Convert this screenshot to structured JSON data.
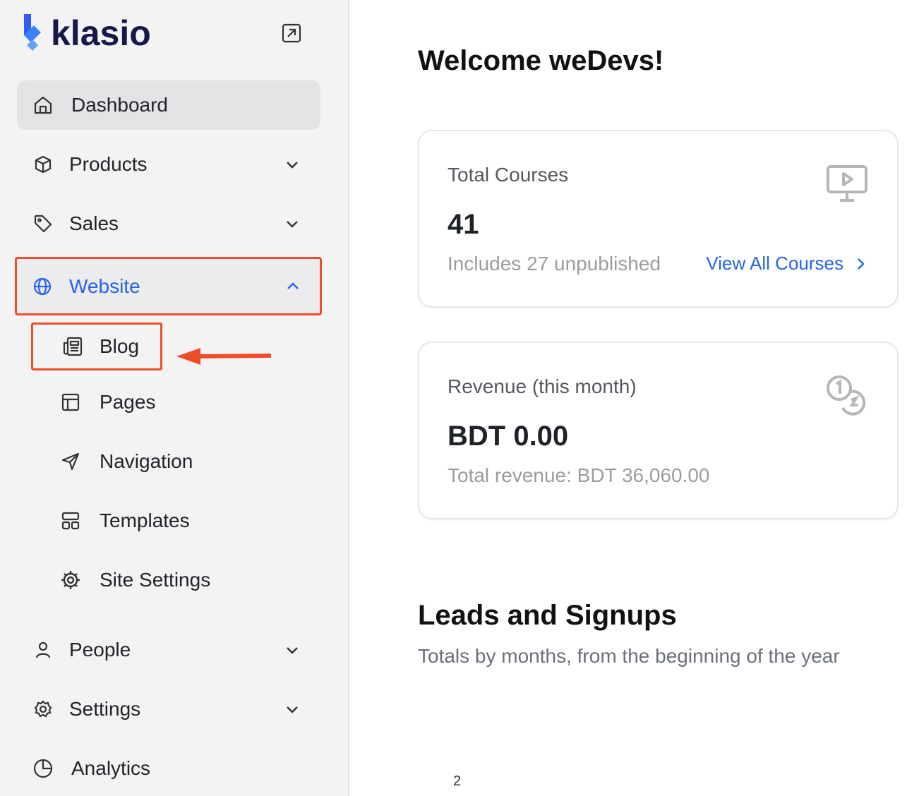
{
  "app": {
    "brand": "klasio"
  },
  "sidebar": {
    "collapse_icon": "external-arrow-icon",
    "items": [
      {
        "label": "Dashboard",
        "icon": "home-icon",
        "active": true
      },
      {
        "label": "Products",
        "icon": "box-icon",
        "expandable": true
      },
      {
        "label": "Sales",
        "icon": "tag-icon",
        "expandable": true
      },
      {
        "label": "Website",
        "icon": "globe-icon",
        "expandable": true,
        "expanded": true
      },
      {
        "label": "People",
        "icon": "user-icon",
        "expandable": true
      },
      {
        "label": "Settings",
        "icon": "gear-icon",
        "expandable": true
      },
      {
        "label": "Analytics",
        "icon": "pie-chart-icon"
      }
    ],
    "website_subitems": [
      {
        "label": "Blog",
        "icon": "newspaper-icon"
      },
      {
        "label": "Pages",
        "icon": "layout-icon"
      },
      {
        "label": "Navigation",
        "icon": "send-icon"
      },
      {
        "label": "Templates",
        "icon": "templates-icon"
      },
      {
        "label": "Site Settings",
        "icon": "cog-icon"
      }
    ]
  },
  "main": {
    "welcome": "Welcome weDevs!",
    "cards": [
      {
        "title": "Total Courses",
        "value": "41",
        "subtitle": "Includes 27 unpublished",
        "link": "View All Courses",
        "icon": "presentation-icon"
      },
      {
        "title": "Revenue (this month)",
        "value": "BDT 0.00",
        "subtitle": "Total revenue: BDT 36,060.00",
        "icon": "coins-icon"
      }
    ],
    "leads": {
      "title": "Leads and Signups",
      "subtitle": "Totals by months, from the beginning of the year",
      "axis_tick": "2"
    }
  },
  "colors": {
    "accent": "#2563eb",
    "highlight": "#ee4d2b",
    "brand_text": "#17184a",
    "sidebar_bg": "#f3f3f4"
  }
}
